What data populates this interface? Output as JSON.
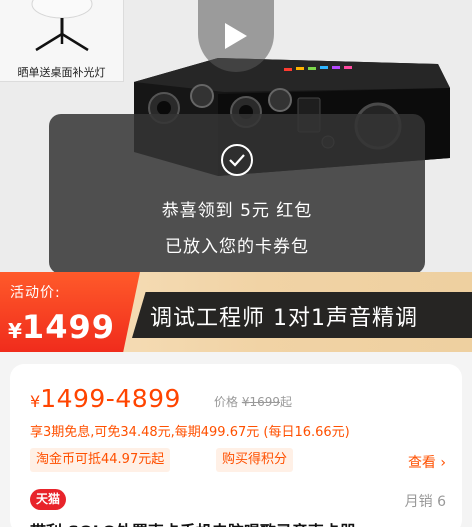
{
  "gallery": {
    "gift_caption": "晒单送桌面补光灯"
  },
  "toast": {
    "line1": "恭喜领到 5元 红包",
    "line2": "已放入您的卡券包"
  },
  "promo": {
    "label": "活动价:",
    "currency": "¥",
    "price": "1499",
    "title": "调试工程师 1对1声音精调"
  },
  "price_card": {
    "currency": "¥",
    "price_range": "1499-4899",
    "original_label": "价格",
    "original_currency": "¥",
    "original_price": "1699",
    "original_suffix": "起",
    "installment": "享3期免息,可免34.48元,每期499.67元 (每日16.66元)",
    "tags": [
      "淘金币可抵44.97元起",
      "购买得积分"
    ],
    "view_link": "查看 ›",
    "store_badge": "天猫",
    "sales": "月销 6",
    "title_peek": "带利 SOLO外置声卡手机电脑唱歌录音声卡器"
  },
  "colors": {
    "accent": "#ff5000",
    "promo_red": "#f02c1c",
    "tmall_red": "#e8242b"
  }
}
